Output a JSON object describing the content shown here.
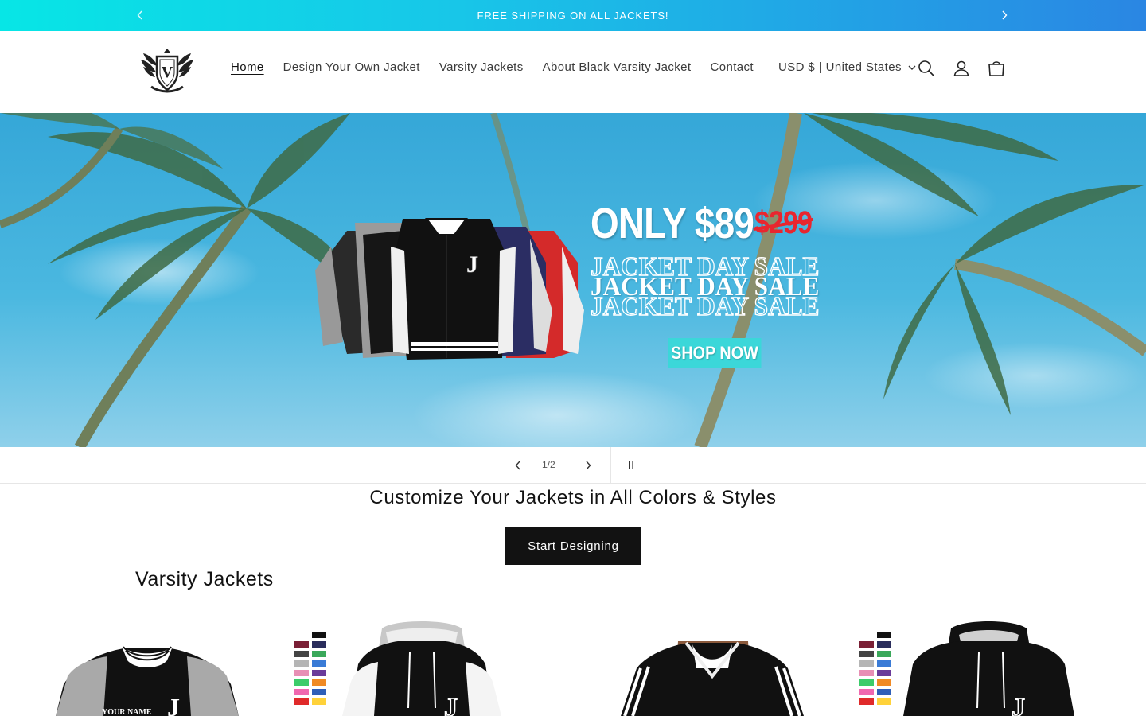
{
  "announcement": {
    "text": "FREE SHIPPING ON ALL JACKETS!",
    "background_from": "#07e6e6",
    "background_to": "#2a86e3"
  },
  "header": {
    "nav": [
      {
        "label": "Home",
        "active": true
      },
      {
        "label": "Design Your Own Jacket",
        "active": false
      },
      {
        "label": "Varsity Jackets",
        "active": false
      },
      {
        "label": "About Black Varsity Jacket",
        "active": false
      },
      {
        "label": "Contact",
        "active": false
      }
    ],
    "currency": "USD $ | United States",
    "icons": [
      "search-icon",
      "account-icon",
      "cart-icon"
    ]
  },
  "hero": {
    "price": "ONLY $89",
    "old_price": "$299",
    "sale_text": "JACKET DAY SALE",
    "cta": "SHOP NOW",
    "cta_color": "#3bd7d9"
  },
  "slider": {
    "counter": "1/2"
  },
  "customize": {
    "title": "Customize Your Jackets in All Colors & Styles",
    "button": "Start Designing"
  },
  "collection": {
    "title": "Varsity Jackets"
  }
}
